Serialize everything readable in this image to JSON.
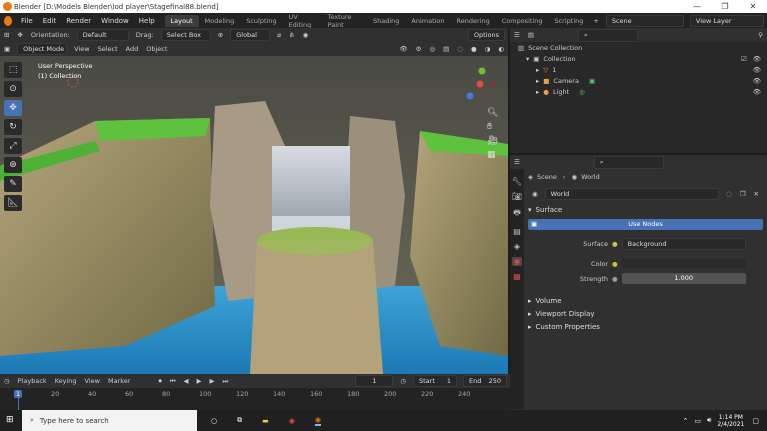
{
  "titlebar": {
    "title": "Blender [D:\\Models Blender\\lod player\\Stagefinal88.blend]",
    "min": "—",
    "max": "❐",
    "close": "✕"
  },
  "menu": {
    "items": [
      "File",
      "Edit",
      "Render",
      "Window",
      "Help"
    ]
  },
  "workspaces": [
    "Layout",
    "Modeling",
    "Sculpting",
    "UV Editing",
    "Texture Paint",
    "Shading",
    "Animation",
    "Rendering",
    "Compositing",
    "Scripting"
  ],
  "scene": {
    "name": "Scene",
    "view_layer": "View Layer"
  },
  "vp_header": {
    "orientation_label": "Orientation:",
    "orientation_value": "Default",
    "drag_label": "Drag:",
    "drag_value": "Select Box",
    "transform_value": "Global",
    "options": "Options",
    "mode": "Object Mode",
    "view": "View",
    "select": "Select",
    "add": "Add",
    "object": "Object"
  },
  "viewport": {
    "perspective": "User Perspective",
    "collection": "(1) Collection"
  },
  "outliner": {
    "root": "Scene Collection",
    "collection": "Collection",
    "items": [
      "1",
      "Camera",
      "Light"
    ]
  },
  "props": {
    "scene": "Scene",
    "world_label": "World",
    "world_name": "World",
    "surface_section": "Surface",
    "use_nodes": "Use Nodes",
    "surface_label": "Surface",
    "surface_value": "Background",
    "color_label": "Color",
    "strength_label": "Strength",
    "strength_value": "1.000",
    "volume": "Volume",
    "viewport_display": "Viewport Display",
    "custom_props": "Custom Properties"
  },
  "timeline": {
    "playback": "Playback",
    "keying": "Keying",
    "view": "View",
    "marker": "Marker",
    "current_frame": "1",
    "start_label": "Start",
    "start": "1",
    "end_label": "End",
    "end": "250",
    "ticks": [
      "1",
      "20",
      "40",
      "60",
      "80",
      "100",
      "120",
      "140",
      "160",
      "180",
      "200",
      "220",
      "240"
    ]
  },
  "taskbar": {
    "search_placeholder": "Type here to search",
    "time": "1:14 PM",
    "date": "2/4/2021"
  },
  "colors": {
    "accent": "#4772b3",
    "blender_orange": "#e87d0d"
  }
}
